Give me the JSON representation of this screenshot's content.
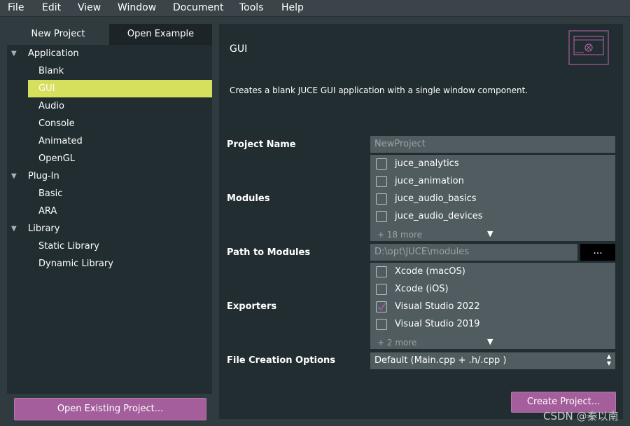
{
  "menu": [
    "File",
    "Edit",
    "View",
    "Window",
    "Document",
    "Tools",
    "Help"
  ],
  "tabs": {
    "new_project": "New Project",
    "open_example": "Open Example"
  },
  "tree": {
    "application": "Application",
    "blank": "Blank",
    "gui": "GUI",
    "audio": "Audio",
    "console": "Console",
    "animated": "Animated",
    "opengl": "OpenGL",
    "plugin": "Plug-In",
    "basic": "Basic",
    "ara": "ARA",
    "library": "Library",
    "static_library": "Static Library",
    "dynamic_library": "Dynamic Library"
  },
  "open_existing_label": "Open Existing Project...",
  "template": {
    "title": "GUI",
    "description": "Creates a blank JUCE GUI application with a single window component."
  },
  "form": {
    "project_name_label": "Project Name",
    "project_name_placeholder": "NewProject",
    "modules_label": "Modules",
    "modules": [
      "juce_analytics",
      "juce_animation",
      "juce_audio_basics",
      "juce_audio_devices"
    ],
    "modules_more": "+ 18 more",
    "path_label": "Path to Modules",
    "path_value": "D:\\opt\\JUCE\\modules",
    "browse_label": "...",
    "exporters_label": "Exporters",
    "exporters": [
      "Xcode (macOS)",
      "Xcode (iOS)",
      "Visual Studio 2022",
      "Visual Studio 2019"
    ],
    "exporters_checked": [
      false,
      false,
      true,
      false
    ],
    "exporters_more": "+ 2 more",
    "file_creation_label": "File Creation Options",
    "file_creation_value": "Default (Main.cpp + .h/.cpp )"
  },
  "create_project_label": "Create Project...",
  "watermark": "CSDN @秦以南",
  "colors": {
    "accent": "#a45e9b",
    "selection": "#d6e05c",
    "panel": "#222d31",
    "background": "#2f3b3f",
    "field": "#505c60"
  },
  "icons": {
    "expand": "chevron-down-icon",
    "more": "triangle-down-icon",
    "checked": "checkmark-icon",
    "template": "gui-window-icon"
  }
}
